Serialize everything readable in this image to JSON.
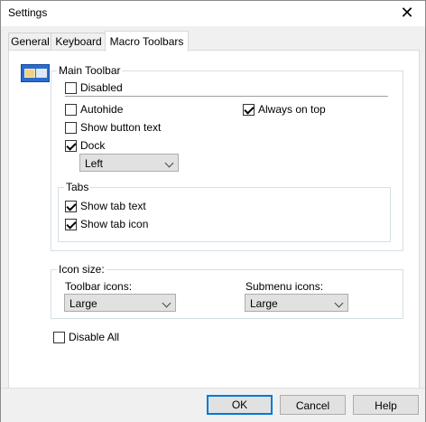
{
  "window": {
    "title": "Settings"
  },
  "tabs": [
    {
      "label": "General"
    },
    {
      "label": "Keyboard"
    },
    {
      "label": "Macro Toolbars"
    }
  ],
  "main_toolbar": {
    "legend": "Main Toolbar",
    "disabled": {
      "label": "Disabled",
      "checked": false
    },
    "autohide": {
      "label": "Autohide",
      "checked": false
    },
    "always_on_top": {
      "label": "Always on top",
      "checked": true
    },
    "show_button_text": {
      "label": "Show button text",
      "checked": false
    },
    "dock": {
      "label": "Dock",
      "checked": true
    },
    "dock_position": {
      "value": "Left"
    },
    "tabs_group": {
      "legend": "Tabs",
      "show_tab_text": {
        "label": "Show tab text",
        "checked": true
      },
      "show_tab_icon": {
        "label": "Show tab icon",
        "checked": true
      }
    }
  },
  "icon_size": {
    "legend": "Icon size:",
    "toolbar_icons": {
      "label": "Toolbar icons:",
      "value": "Large"
    },
    "submenu_icons": {
      "label": "Submenu icons:",
      "value": "Large"
    }
  },
  "disable_all": {
    "label": "Disable All",
    "checked": false
  },
  "buttons": {
    "ok": "OK",
    "cancel": "Cancel",
    "help": "Help"
  }
}
